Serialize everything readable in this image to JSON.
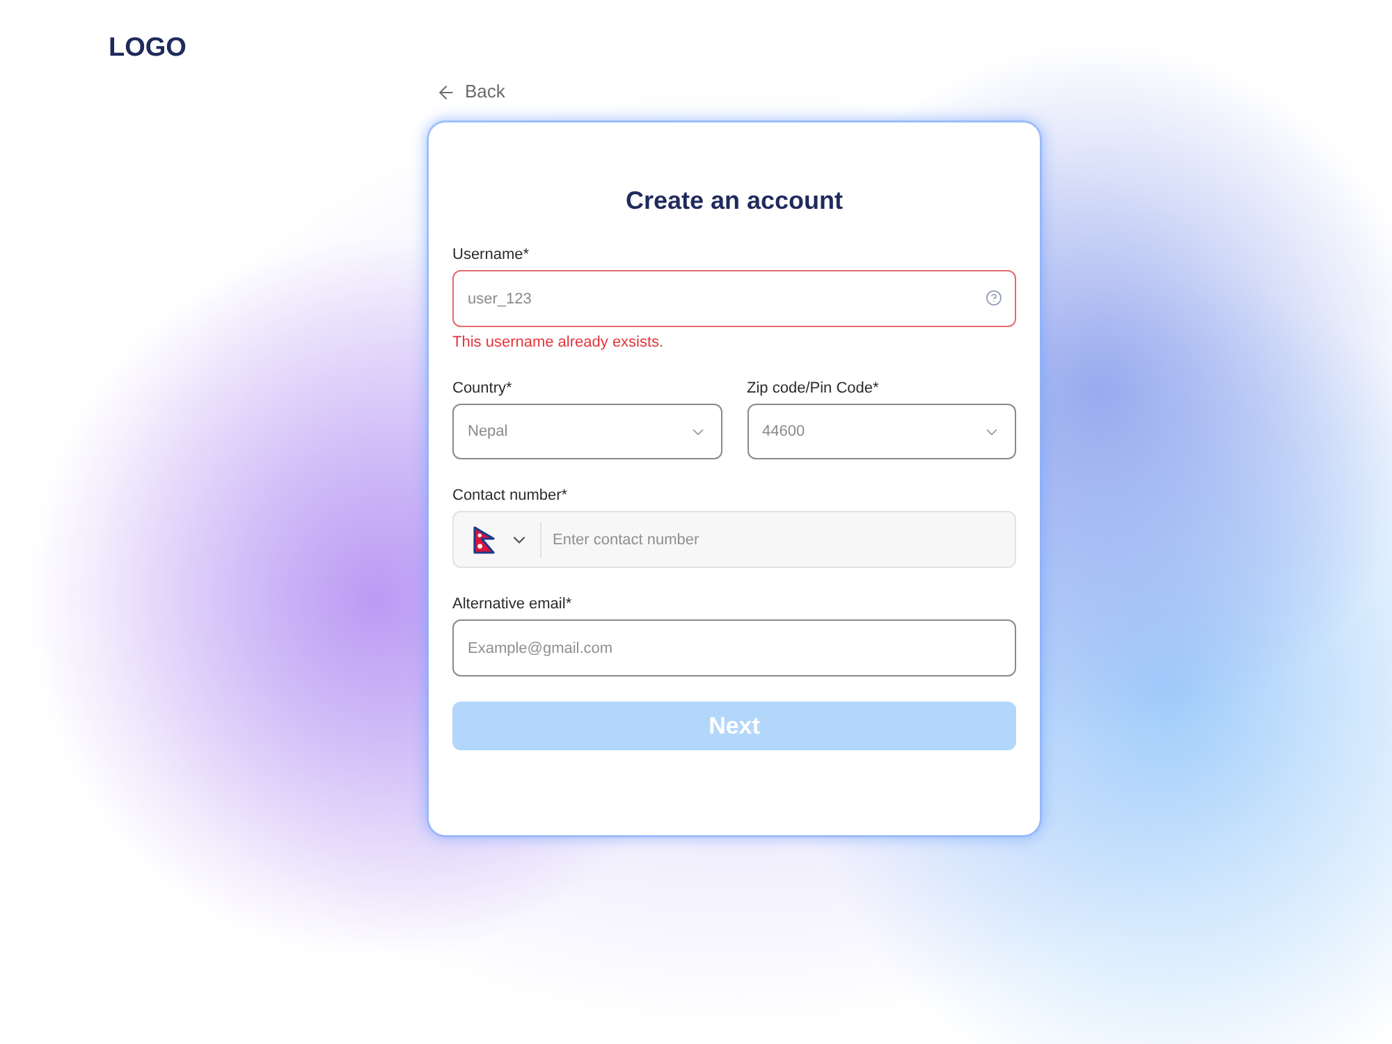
{
  "logo": {
    "text": "LOGO"
  },
  "back_link": {
    "label": "Back"
  },
  "form": {
    "title": "Create an account",
    "rows": [
      {
        "fields": [
          {
            "kind": "text",
            "label": "Username*",
            "value": "user_123",
            "invalid": true,
            "error": "This username already exsists."
          }
        ]
      },
      {
        "fields": [
          {
            "kind": "select",
            "label": "Country*",
            "value": "Nepal",
            "invalid": false
          },
          {
            "kind": "select",
            "label": "Zip code/Pin Code*",
            "value": "44600",
            "invalid": false
          }
        ]
      },
      {
        "fields": [
          {
            "kind": "phone",
            "label": "Contact number*",
            "placeholder": "Enter contact number",
            "invalid": false
          }
        ]
      },
      {
        "fields": [
          {
            "kind": "text",
            "label": "Alternative email*",
            "placeholder": "Example@gmail.com",
            "invalid": false
          }
        ]
      }
    ],
    "submit": {
      "label": "Next",
      "disabled": true
    }
  }
}
